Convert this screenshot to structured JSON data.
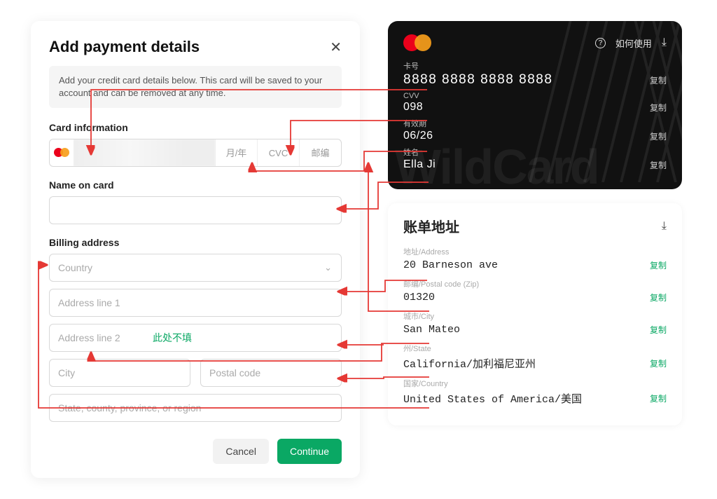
{
  "modal": {
    "title": "Add payment details",
    "info": "Add your credit card details below. This card will be saved to your account and can be removed at any time.",
    "card_info_label": "Card information",
    "card_expiry_ph": "月/年",
    "card_cvc_ph": "CVC",
    "card_zip_ph": "邮编",
    "name_label": "Name on card",
    "billing_label": "Billing address",
    "country_ph": "Country",
    "addr1_ph": "Address line 1",
    "addr2_ph": "Address line 2",
    "addr2_hint": "此处不填",
    "city_ph": "City",
    "postal_ph": "Postal code",
    "state_ph": "State, county, province, or region",
    "cancel": "Cancel",
    "continue": "Continue"
  },
  "card": {
    "how_to": "如何使用",
    "number_label": "卡号",
    "number": "8888 8888 8888 8888",
    "cvv_label": "CVV",
    "cvv": "098",
    "expiry_label": "有效期",
    "expiry": "06/26",
    "name_label": "姓名",
    "name": "Ella Ji",
    "copy": "复制",
    "watermark": "WildCard"
  },
  "billing": {
    "title": "账单地址",
    "address_label": "地址/Address",
    "address": "20 Barneson ave",
    "postal_label": "邮编/Postal code (Zip)",
    "postal": "01320",
    "city_label": "城市/City",
    "city": "San Mateo",
    "state_label": "州/State",
    "state": "California/加利福尼亚州",
    "country_label": "国家/Country",
    "country": "United States of America/美国",
    "copy": "复制"
  }
}
